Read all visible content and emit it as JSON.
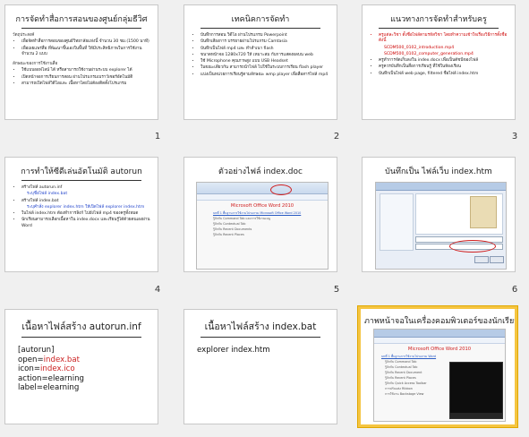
{
  "slides": [
    {
      "number": "1",
      "title": "การจัดทำสื่อการสอนของศูนย์กลุ่มธีวิศ",
      "sections": [
        {
          "heading": "วัตถุประสงค์",
          "bullets": [
            "เพื่อจัดทำสื่อการสอนของศูนย์วิทยาลัยแห่งนี้ จำนวน 30 ชม.(1500 นาที)",
            "เพื่อเผยแพร่สื่อ ที่พัฒนาขึ้นเองในพื้นที่ ให้มีประสิทธิภาพในการใช้งาน จำนวน 2 แบบ"
          ]
        },
        {
          "heading": "ลักษณะของการใช้งานสื่อ",
          "bullets": [
            "ใช้แบบออฟไลน์ ได้ หรือสามารถใช้งานผ่านระบบ explorer ได้",
            "เปิดหน้าจอการเรียนการสอน ผ่านโปรแกรมเบราว์เซอร์อัตโนมัติ",
            "สามารถเปิดไฟล์วิดีโอและ เนื้อหาโดยไม่ต้องติดตั้งโปรแกรม"
          ]
        }
      ]
    },
    {
      "number": "2",
      "title": "เทคนิคการจัดทำ",
      "bullets": [
        "บันทึกการสอน วิดีโอ ผ่านโปรแกรม Powerpoint",
        "บันทึกเสียงการ บรรยายผ่านโปรแกรม Camtasia",
        "บันทึกเป็นไฟล์ mp4 และ ทำสำเนา flash",
        "ขนาดหน้าจอ 1280x720 ให้ เหมาะสม กับการแสดงผลบน web",
        "ใช้ Microphone คุณภาพสูง แบบ USB Headset",
        "ในขณะเดียวกัน สามารถนำไฟล์ ไปใช้ในระบบการเรียน flash player",
        "แบ่งเป็นหน่วยการเรียนรู้ตามลักษณะ wmp player เพื่อสื่อสารไฟล์ mp4"
      ]
    },
    {
      "number": "3",
      "title": "แนวทางการจัดทำสำหรับครู",
      "bullets": [
        {
          "text": "ครูแต่ละวิชา ตั้งชื่อไฟล์ตามรหัสวิชา โดยทำความเข้าใจเรื่องวิธีการตั้งชื่อ ดังนี้",
          "red": true
        },
        {
          "text": "SCDM500_0102_introduction.mp4",
          "red": true,
          "indent": true
        },
        {
          "text": "SCDM500_0102_computer_generation.mp4",
          "red": true,
          "indent": true
        },
        {
          "text": "ครูทำการจัดเก็บลงใน index.docx เพื่อเป็นดัชนีของไฟล์",
          "red": false
        },
        {
          "text": "ครูควรบันทึกเป็นสื่อการเรียนรู้ ที่ใช้ในห้องเรียน",
          "red": false
        },
        {
          "text": "บันทึกเป็นไฟล์ web page, filtered ชื่อไฟล์ index.htm",
          "red": false
        }
      ]
    },
    {
      "number": "4",
      "title": "การทำให้ซีดีเล่นอัตโนมัติ autorun",
      "items": [
        {
          "text": "สร้างไฟล์ autorun.inf",
          "sub": "ระบุชื่อไฟล์ index.bat"
        },
        {
          "text": "สร้างไฟล์ index.bat",
          "sub": "ระบุคำสั่ง explorer index.htm ให้เปิดไฟล์ explorer index.htm"
        },
        {
          "text": "ในไฟล์ index.htm ต้องทำการลิงก์ ไปยังไฟล์ mp4 ของครูทั้งหมด"
        },
        {
          "text": "นักเรียนสามารถเลือกเนื้อหาใน index.docx และเรียนรู้ได้ด้วยตนเองผ่าน Word"
        }
      ]
    },
    {
      "number": "5",
      "title": "ตัวอย่างไฟล์ index.doc",
      "mock_title": "Microsoft Office Word 2010",
      "mock_lines": [
        "บทที่ 1 พื้นฐานการใช้งานโปรแกรม Microsoft Office Word 2010",
        "รู้จักกับ Command Tab และการใช้งานเมนู",
        "รู้จักกับ Contextual Tab",
        "รู้จักกับ Recent Documents",
        "รู้จักกับ Recent Places"
      ]
    },
    {
      "number": "6",
      "title": "บันทึกเป็น ไฟล์เว็บ index.htm"
    },
    {
      "number": "",
      "title": "เนื้อหาไฟล์สร้าง autorun.inf",
      "code": [
        "[autorun]",
        "open=",
        "index.bat",
        "icon=",
        "index.ico",
        "action=elearning",
        "label=elearning"
      ]
    },
    {
      "number": "",
      "title": "เนื้อหาไฟล์สร้าง index.bat",
      "code": [
        "explorer index.htm"
      ]
    },
    {
      "number": "",
      "title": "ภาพหน้าจอในเครื่องคอมพิวเตอร์ของนักเรียน",
      "mock_title": "Microsoft Office Word 2010",
      "mock_lines": [
        "บทที่ 1 พื้นฐานการใช้งานโปรแกรม Word",
        "รู้จักกับ Command Tab",
        "รู้จักกับ Contextual Tab",
        "รู้จักกับ Recent Document",
        "รู้จักกับ Recent Places",
        "รู้จักกับ Quick Access Toolbar",
        "การปรับแต่ง Ribbon",
        "การใช้งาน Backstage View"
      ]
    }
  ]
}
